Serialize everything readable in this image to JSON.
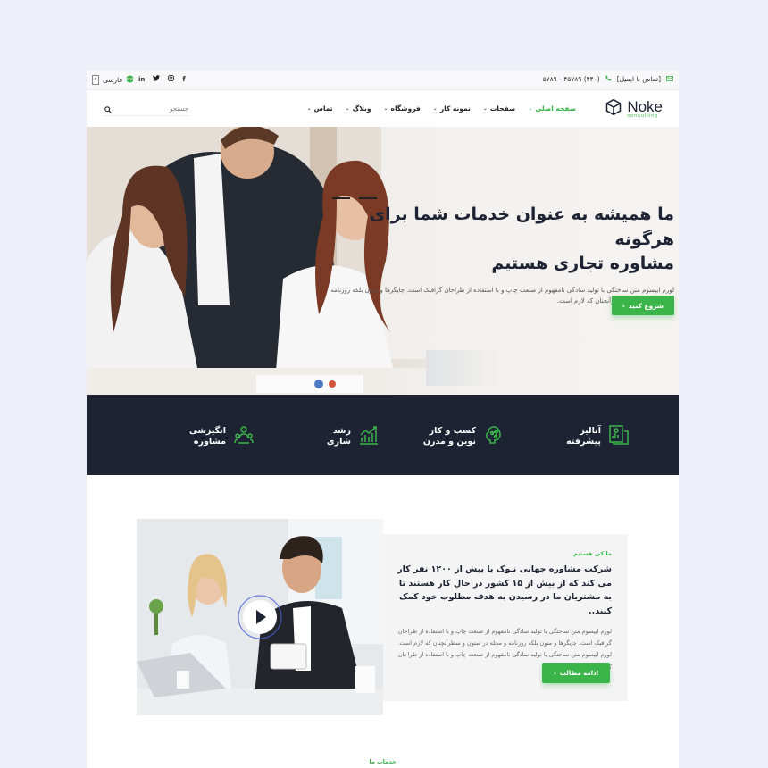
{
  "topbar": {
    "language": "فارسی",
    "contact_label": "[تماس با ایمیل]",
    "phone": "(۴۴۰) ۴۵۷۸۹ - ۵۷۸۹",
    "socials": [
      "facebook-icon",
      "instagram-icon",
      "twitter-icon",
      "linkedin-icon"
    ]
  },
  "nav": {
    "logo_name": "Noke",
    "logo_sub": "consulting",
    "items": [
      {
        "label": "صفحه اصلی"
      },
      {
        "label": "صفحات"
      },
      {
        "label": "نمونه کار"
      },
      {
        "label": "فروشگاه"
      },
      {
        "label": "وبلاگ"
      },
      {
        "label": "تماس"
      }
    ],
    "search_placeholder": "جستجو"
  },
  "hero": {
    "title_line1": "ما همیشه به عنوان خدمات شما برای هرگونه",
    "title_line2": "مشاوره تجاری هستیم",
    "desc": "لورم ایپسوم متن ساختگی با تولید سادگی نامفهوم از صنعت چاپ و با استفاده از طراحان گرافیک است. چاپگرها و متون بلکه روزنامه و مجله در ستون و سطرآنچنان که لازم است.",
    "button": "شروع کنید"
  },
  "features": [
    {
      "line1": "آنالیز",
      "line2": "پیشرفته",
      "icon": "analytics-icon"
    },
    {
      "line1": "کسب و کار",
      "line2": "نوین و مدرن",
      "icon": "brain-icon"
    },
    {
      "line1": "رشد",
      "line2": "شاری",
      "icon": "growth-chart-icon"
    },
    {
      "line1": "انگیزشی",
      "line2": "مشاوره",
      "icon": "team-icon"
    }
  ],
  "about": {
    "tag": "ما کی هستیم",
    "title": "شرکت مشاوره جهانی نـوک با بیش از ۱۲۰۰ نفر کار می کند که از بیش از ۱۵ کشور در حال کار هستند تا به مشتریان ما در رسیدن به هدف مطلوب خود کمک کنند..",
    "desc": "لورم ایپسوم متن ساختگی با تولید سادگی نامفهوم از صنعت چاپ و با استفاده از طراحان گرافیک است. چاپگرها و متون بلکه روزنامه و مجله در ستون و سطرآنچنان که لازم است. لورم ایپسوم متن ساختگی با تولید سادگی نامفهوم از صنعت چاپ و با استفاده از طراحان گرافیک است.",
    "button": "ادامه مطالب"
  },
  "services_tag": "خدمات ما",
  "colors": {
    "accent": "#3bb54a",
    "dark": "#1d2333"
  }
}
